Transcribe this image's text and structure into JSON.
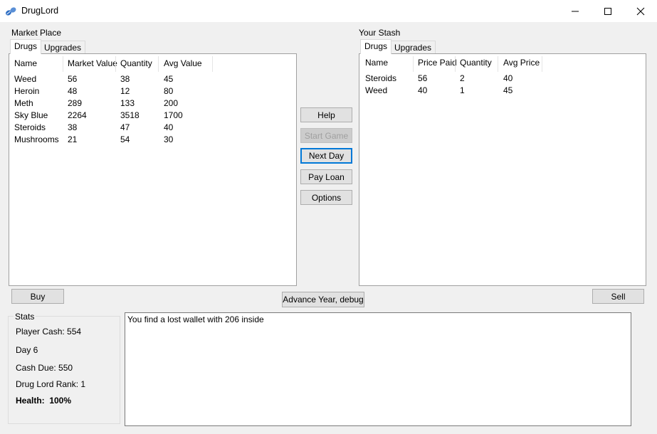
{
  "window": {
    "title": "DrugLord"
  },
  "market": {
    "label": "Market Place",
    "tabs": [
      "Drugs",
      "Upgrades"
    ],
    "columns": [
      "Name",
      "Market Value",
      "Quantity",
      "Avg Value"
    ],
    "rows": [
      [
        "Weed",
        "56",
        "38",
        "45"
      ],
      [
        "Heroin",
        "48",
        "12",
        "80"
      ],
      [
        "Meth",
        "289",
        "133",
        "200"
      ],
      [
        "Sky Blue",
        "2264",
        "3518",
        "1700"
      ],
      [
        "Steroids",
        "38",
        "47",
        "40"
      ],
      [
        "Mushrooms",
        "21",
        "54",
        "30"
      ]
    ]
  },
  "stash": {
    "label": "Your Stash",
    "tabs": [
      "Drugs",
      "Upgrades"
    ],
    "columns": [
      "Name",
      "Price Paid",
      "Quantity",
      "Avg Price"
    ],
    "rows": [
      [
        "Steroids",
        "56",
        "2",
        "40"
      ],
      [
        "Weed",
        "40",
        "1",
        "45"
      ]
    ]
  },
  "buttons": {
    "help": "Help",
    "start_game": "Start Game",
    "next_day": "Next Day",
    "pay_loan": "Pay Loan",
    "options": "Options",
    "buy": "Buy",
    "advance_year": "Advance Year, debug",
    "sell": "Sell"
  },
  "stats": {
    "title": "Stats",
    "player_cash": "Player Cash: 554",
    "day": "Day 6",
    "cash_due": "Cash Due: 550",
    "rank": "Drug Lord Rank: 1",
    "health": "Health:  100%"
  },
  "log": {
    "text": "You find a lost wallet with 206 inside"
  },
  "colors": {
    "accent": "#0078d7",
    "panel_bg": "#ffffff",
    "window_bg": "#f0f0f0",
    "pill_blue": "#2f6fc4"
  },
  "icons": {
    "app": "pills-icon",
    "minimize": "minimize-icon",
    "maximize": "maximize-icon",
    "close": "close-icon"
  }
}
